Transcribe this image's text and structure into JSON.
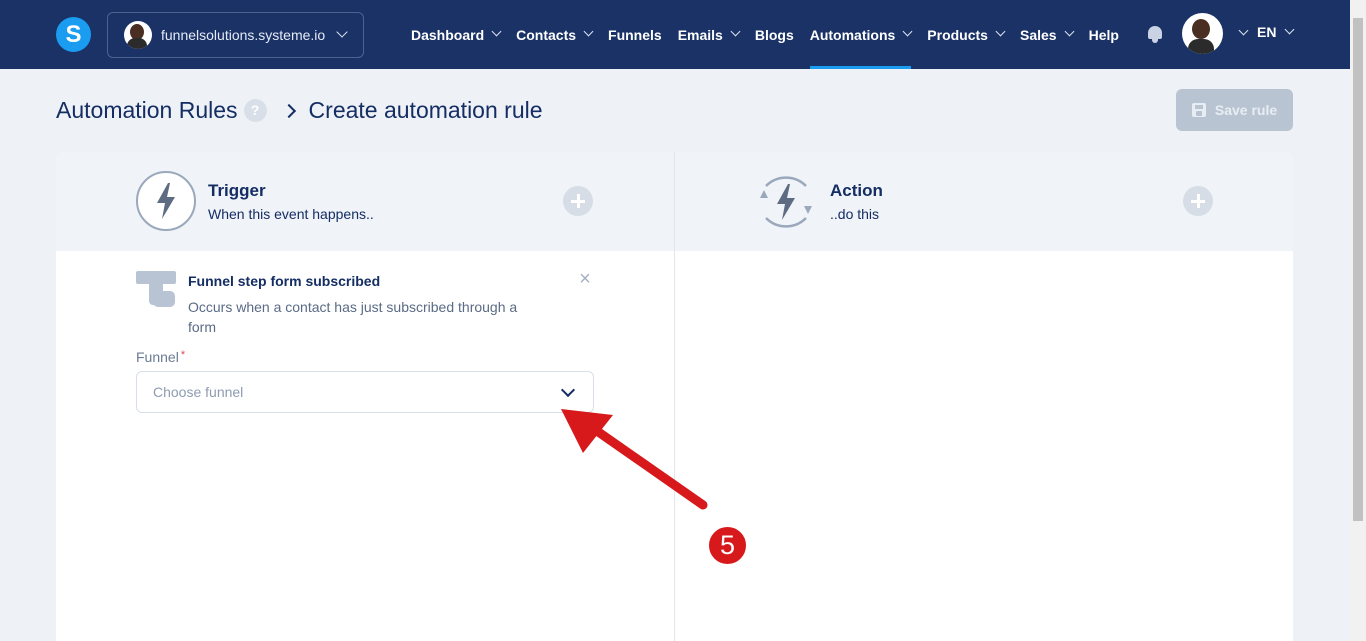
{
  "app": {
    "logo_letter": "S",
    "workspace": "funnelsolutions.systeme.io",
    "accent_color": "#1a9cf0",
    "nav_bg_color": "#1a3266"
  },
  "nav": {
    "items": [
      {
        "label": "Dashboard",
        "dropdown": true
      },
      {
        "label": "Contacts",
        "dropdown": true
      },
      {
        "label": "Funnels",
        "dropdown": false
      },
      {
        "label": "Emails",
        "dropdown": true
      },
      {
        "label": "Blogs",
        "dropdown": false
      },
      {
        "label": "Automations",
        "dropdown": true,
        "active": true
      },
      {
        "label": "Products",
        "dropdown": true
      },
      {
        "label": "Sales",
        "dropdown": true
      },
      {
        "label": "Help",
        "dropdown": false
      }
    ],
    "bell_icon": "bell-icon",
    "language": "EN"
  },
  "header": {
    "breadcrumb_root": "Automation Rules",
    "help_glyph": "?",
    "page_title": "Create automation rule",
    "save_label": "Save rule"
  },
  "trigger": {
    "title": "Trigger",
    "subtitle": "When this event happens.."
  },
  "action": {
    "title": "Action",
    "subtitle": "..do this"
  },
  "trigger_detail": {
    "title": "Funnel step form subscribed",
    "description": "Occurs when a contact has just subscribed through a form",
    "close_glyph": "×",
    "funnel_label": "Funnel",
    "required_mark": "*",
    "funnel_placeholder": "Choose funnel"
  },
  "annotation": {
    "step_number": "5",
    "color": "#d7191c"
  }
}
